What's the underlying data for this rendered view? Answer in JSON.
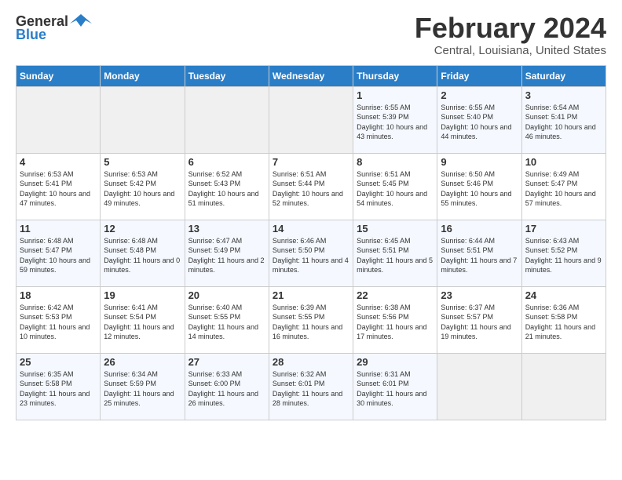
{
  "header": {
    "logo_general": "General",
    "logo_blue": "Blue",
    "title": "February 2024",
    "subtitle": "Central, Louisiana, United States"
  },
  "days_of_week": [
    "Sunday",
    "Monday",
    "Tuesday",
    "Wednesday",
    "Thursday",
    "Friday",
    "Saturday"
  ],
  "weeks": [
    [
      {
        "day": "",
        "sunrise": "",
        "sunset": "",
        "daylight": "",
        "empty": true
      },
      {
        "day": "",
        "sunrise": "",
        "sunset": "",
        "daylight": "",
        "empty": true
      },
      {
        "day": "",
        "sunrise": "",
        "sunset": "",
        "daylight": "",
        "empty": true
      },
      {
        "day": "",
        "sunrise": "",
        "sunset": "",
        "daylight": "",
        "empty": true
      },
      {
        "day": "1",
        "sunrise": "Sunrise: 6:55 AM",
        "sunset": "Sunset: 5:39 PM",
        "daylight": "Daylight: 10 hours and 43 minutes.",
        "empty": false
      },
      {
        "day": "2",
        "sunrise": "Sunrise: 6:55 AM",
        "sunset": "Sunset: 5:40 PM",
        "daylight": "Daylight: 10 hours and 44 minutes.",
        "empty": false
      },
      {
        "day": "3",
        "sunrise": "Sunrise: 6:54 AM",
        "sunset": "Sunset: 5:41 PM",
        "daylight": "Daylight: 10 hours and 46 minutes.",
        "empty": false
      }
    ],
    [
      {
        "day": "4",
        "sunrise": "Sunrise: 6:53 AM",
        "sunset": "Sunset: 5:41 PM",
        "daylight": "Daylight: 10 hours and 47 minutes.",
        "empty": false
      },
      {
        "day": "5",
        "sunrise": "Sunrise: 6:53 AM",
        "sunset": "Sunset: 5:42 PM",
        "daylight": "Daylight: 10 hours and 49 minutes.",
        "empty": false
      },
      {
        "day": "6",
        "sunrise": "Sunrise: 6:52 AM",
        "sunset": "Sunset: 5:43 PM",
        "daylight": "Daylight: 10 hours and 51 minutes.",
        "empty": false
      },
      {
        "day": "7",
        "sunrise": "Sunrise: 6:51 AM",
        "sunset": "Sunset: 5:44 PM",
        "daylight": "Daylight: 10 hours and 52 minutes.",
        "empty": false
      },
      {
        "day": "8",
        "sunrise": "Sunrise: 6:51 AM",
        "sunset": "Sunset: 5:45 PM",
        "daylight": "Daylight: 10 hours and 54 minutes.",
        "empty": false
      },
      {
        "day": "9",
        "sunrise": "Sunrise: 6:50 AM",
        "sunset": "Sunset: 5:46 PM",
        "daylight": "Daylight: 10 hours and 55 minutes.",
        "empty": false
      },
      {
        "day": "10",
        "sunrise": "Sunrise: 6:49 AM",
        "sunset": "Sunset: 5:47 PM",
        "daylight": "Daylight: 10 hours and 57 minutes.",
        "empty": false
      }
    ],
    [
      {
        "day": "11",
        "sunrise": "Sunrise: 6:48 AM",
        "sunset": "Sunset: 5:47 PM",
        "daylight": "Daylight: 10 hours and 59 minutes.",
        "empty": false
      },
      {
        "day": "12",
        "sunrise": "Sunrise: 6:48 AM",
        "sunset": "Sunset: 5:48 PM",
        "daylight": "Daylight: 11 hours and 0 minutes.",
        "empty": false
      },
      {
        "day": "13",
        "sunrise": "Sunrise: 6:47 AM",
        "sunset": "Sunset: 5:49 PM",
        "daylight": "Daylight: 11 hours and 2 minutes.",
        "empty": false
      },
      {
        "day": "14",
        "sunrise": "Sunrise: 6:46 AM",
        "sunset": "Sunset: 5:50 PM",
        "daylight": "Daylight: 11 hours and 4 minutes.",
        "empty": false
      },
      {
        "day": "15",
        "sunrise": "Sunrise: 6:45 AM",
        "sunset": "Sunset: 5:51 PM",
        "daylight": "Daylight: 11 hours and 5 minutes.",
        "empty": false
      },
      {
        "day": "16",
        "sunrise": "Sunrise: 6:44 AM",
        "sunset": "Sunset: 5:51 PM",
        "daylight": "Daylight: 11 hours and 7 minutes.",
        "empty": false
      },
      {
        "day": "17",
        "sunrise": "Sunrise: 6:43 AM",
        "sunset": "Sunset: 5:52 PM",
        "daylight": "Daylight: 11 hours and 9 minutes.",
        "empty": false
      }
    ],
    [
      {
        "day": "18",
        "sunrise": "Sunrise: 6:42 AM",
        "sunset": "Sunset: 5:53 PM",
        "daylight": "Daylight: 11 hours and 10 minutes.",
        "empty": false
      },
      {
        "day": "19",
        "sunrise": "Sunrise: 6:41 AM",
        "sunset": "Sunset: 5:54 PM",
        "daylight": "Daylight: 11 hours and 12 minutes.",
        "empty": false
      },
      {
        "day": "20",
        "sunrise": "Sunrise: 6:40 AM",
        "sunset": "Sunset: 5:55 PM",
        "daylight": "Daylight: 11 hours and 14 minutes.",
        "empty": false
      },
      {
        "day": "21",
        "sunrise": "Sunrise: 6:39 AM",
        "sunset": "Sunset: 5:55 PM",
        "daylight": "Daylight: 11 hours and 16 minutes.",
        "empty": false
      },
      {
        "day": "22",
        "sunrise": "Sunrise: 6:38 AM",
        "sunset": "Sunset: 5:56 PM",
        "daylight": "Daylight: 11 hours and 17 minutes.",
        "empty": false
      },
      {
        "day": "23",
        "sunrise": "Sunrise: 6:37 AM",
        "sunset": "Sunset: 5:57 PM",
        "daylight": "Daylight: 11 hours and 19 minutes.",
        "empty": false
      },
      {
        "day": "24",
        "sunrise": "Sunrise: 6:36 AM",
        "sunset": "Sunset: 5:58 PM",
        "daylight": "Daylight: 11 hours and 21 minutes.",
        "empty": false
      }
    ],
    [
      {
        "day": "25",
        "sunrise": "Sunrise: 6:35 AM",
        "sunset": "Sunset: 5:58 PM",
        "daylight": "Daylight: 11 hours and 23 minutes.",
        "empty": false
      },
      {
        "day": "26",
        "sunrise": "Sunrise: 6:34 AM",
        "sunset": "Sunset: 5:59 PM",
        "daylight": "Daylight: 11 hours and 25 minutes.",
        "empty": false
      },
      {
        "day": "27",
        "sunrise": "Sunrise: 6:33 AM",
        "sunset": "Sunset: 6:00 PM",
        "daylight": "Daylight: 11 hours and 26 minutes.",
        "empty": false
      },
      {
        "day": "28",
        "sunrise": "Sunrise: 6:32 AM",
        "sunset": "Sunset: 6:01 PM",
        "daylight": "Daylight: 11 hours and 28 minutes.",
        "empty": false
      },
      {
        "day": "29",
        "sunrise": "Sunrise: 6:31 AM",
        "sunset": "Sunset: 6:01 PM",
        "daylight": "Daylight: 11 hours and 30 minutes.",
        "empty": false
      },
      {
        "day": "",
        "sunrise": "",
        "sunset": "",
        "daylight": "",
        "empty": true
      },
      {
        "day": "",
        "sunrise": "",
        "sunset": "",
        "daylight": "",
        "empty": true
      }
    ]
  ]
}
